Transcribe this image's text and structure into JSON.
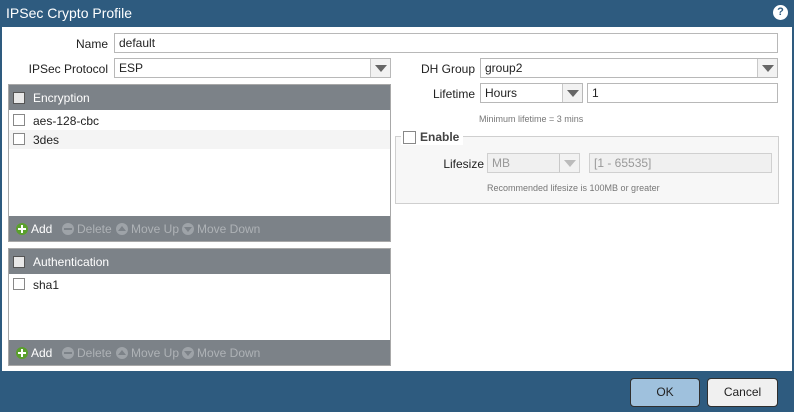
{
  "window": {
    "title": "IPSec Crypto Profile",
    "help_icon": "?"
  },
  "form": {
    "name_label": "Name",
    "name_value": "default",
    "protocol_label": "IPSec Protocol",
    "protocol_value": "ESP",
    "dh_label": "DH Group",
    "dh_value": "group2",
    "lifetime_label": "Lifetime",
    "lifetime_unit": "Hours",
    "lifetime_value": "1",
    "lifetime_note": "Minimum lifetime = 3 mins",
    "enable_label": "Enable",
    "lifesize_label": "Lifesize",
    "lifesize_unit": "MB",
    "lifesize_placeholder": "[1 - 65535]",
    "lifesize_note": "Recommended lifesize is 100MB or greater"
  },
  "encryption": {
    "header": "Encryption",
    "rows": [
      "aes-128-cbc",
      "3des"
    ]
  },
  "authentication": {
    "header": "Authentication",
    "rows": [
      "sha1"
    ]
  },
  "toolbar": {
    "add": "Add",
    "delete": "Delete",
    "move_up": "Move Up",
    "move_down": "Move Down"
  },
  "footer": {
    "ok": "OK",
    "cancel": "Cancel"
  },
  "colors": {
    "titlebar": "#2e5b7f",
    "grid_header": "#7c8288",
    "ok_button": "#9fc1dd"
  }
}
